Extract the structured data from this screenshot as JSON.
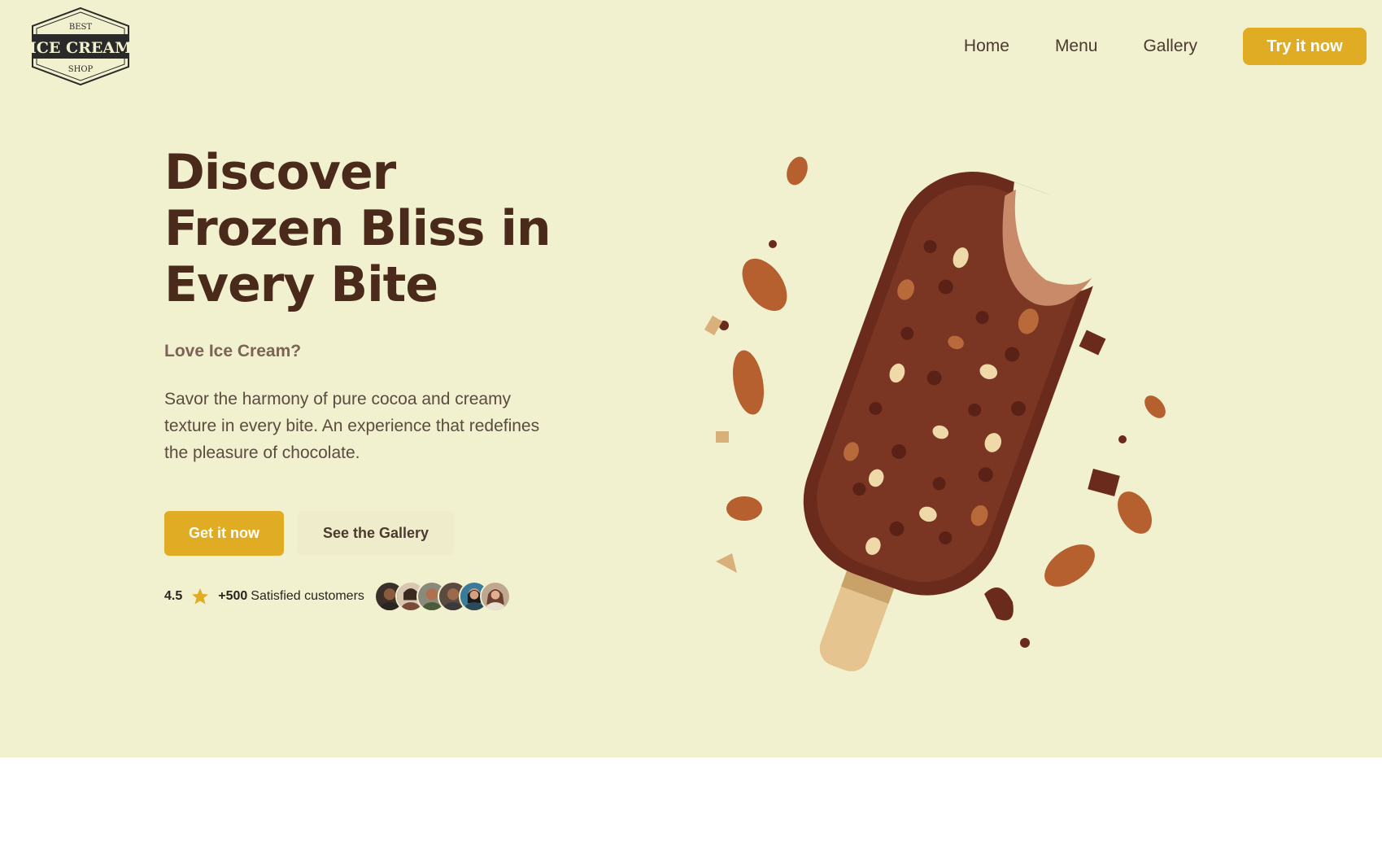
{
  "logo": {
    "top_text": "BEST",
    "main_text": "ICE CREAM",
    "bottom_text": "SHOP"
  },
  "nav": {
    "links": [
      "Home",
      "Menu",
      "Gallery"
    ],
    "cta": "Try it now"
  },
  "hero": {
    "title": "Discover Frozen Bliss in Every Bite",
    "subtitle": "Love Ice Cream?",
    "description": "Savor the harmony of pure cocoa and creamy texture in every bite. An experience that redefines the pleasure of chocolate.",
    "primary_button": "Get it now",
    "secondary_button": "See the Gallery",
    "rating": "4.5",
    "customers_count": "+500",
    "customers_label": "Satisfied customers",
    "avatar_count": 6
  },
  "colors": {
    "hero_background": "#f1f0cf",
    "accent": "#e0ac23",
    "heading": "#4a2a1b",
    "chocolate": "#6a2b1c"
  },
  "icons": [
    "star-icon"
  ]
}
